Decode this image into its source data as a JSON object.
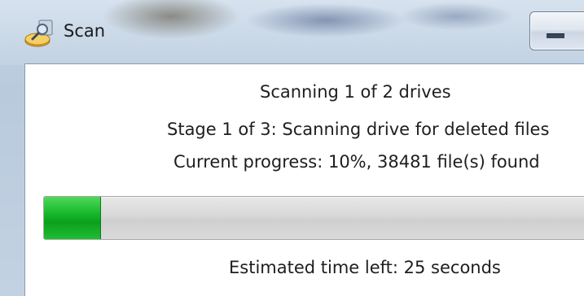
{
  "window": {
    "title": "Scan",
    "icon": "scan-app-icon",
    "minimize_icon": "minimize-icon"
  },
  "status": {
    "drives_line": "Scanning 1 of 2 drives",
    "stage_line": "Stage 1 of 3: Scanning drive for deleted files",
    "progress_line": "Current progress: 10%, 38481 file(s) found",
    "time_left_line": "Estimated time left: 25 seconds"
  },
  "progress": {
    "fraction": 0.1,
    "fill_color": "#17b82a"
  }
}
